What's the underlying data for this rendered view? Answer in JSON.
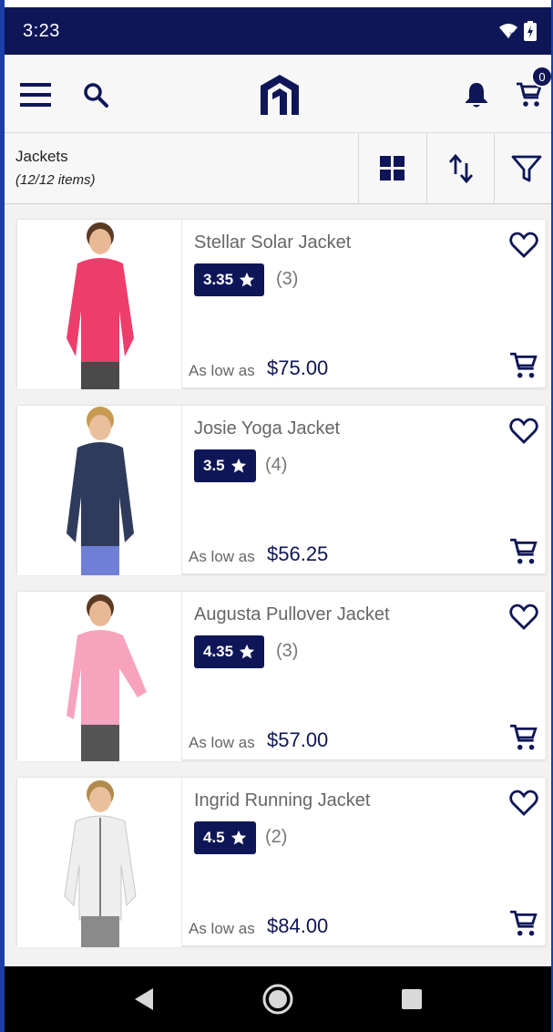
{
  "status": {
    "time": "3:23"
  },
  "header": {
    "cart_count": "0"
  },
  "toolbar": {
    "category": "Jackets",
    "count": "(12/12 items)"
  },
  "price_prefix": "As low as",
  "products": [
    {
      "name": "Stellar Solar Jacket",
      "rating": "3.35",
      "reviews": "(3)",
      "price": "$75.00",
      "shirt_color": "#ee3d6b",
      "pants_color": "#4a4a4a"
    },
    {
      "name": "Josie Yoga Jacket",
      "rating": "3.5",
      "reviews": "(4)",
      "price": "$56.25",
      "shirt_color": "#2f3b5c",
      "pants_color": "#6f7fd6"
    },
    {
      "name": "Augusta Pullover Jacket",
      "rating": "4.35",
      "reviews": "(3)",
      "price": "$57.00",
      "shirt_color": "#f7a3bd",
      "pants_color": "#555555"
    },
    {
      "name": "Ingrid Running Jacket",
      "rating": "4.5",
      "reviews": "(2)",
      "price": "$84.00",
      "shirt_color": "#eeeeee",
      "pants_color": "#8a8a8a"
    }
  ],
  "colors": {
    "brand": "#0f1657",
    "accent_border": "#1a3fa8"
  }
}
